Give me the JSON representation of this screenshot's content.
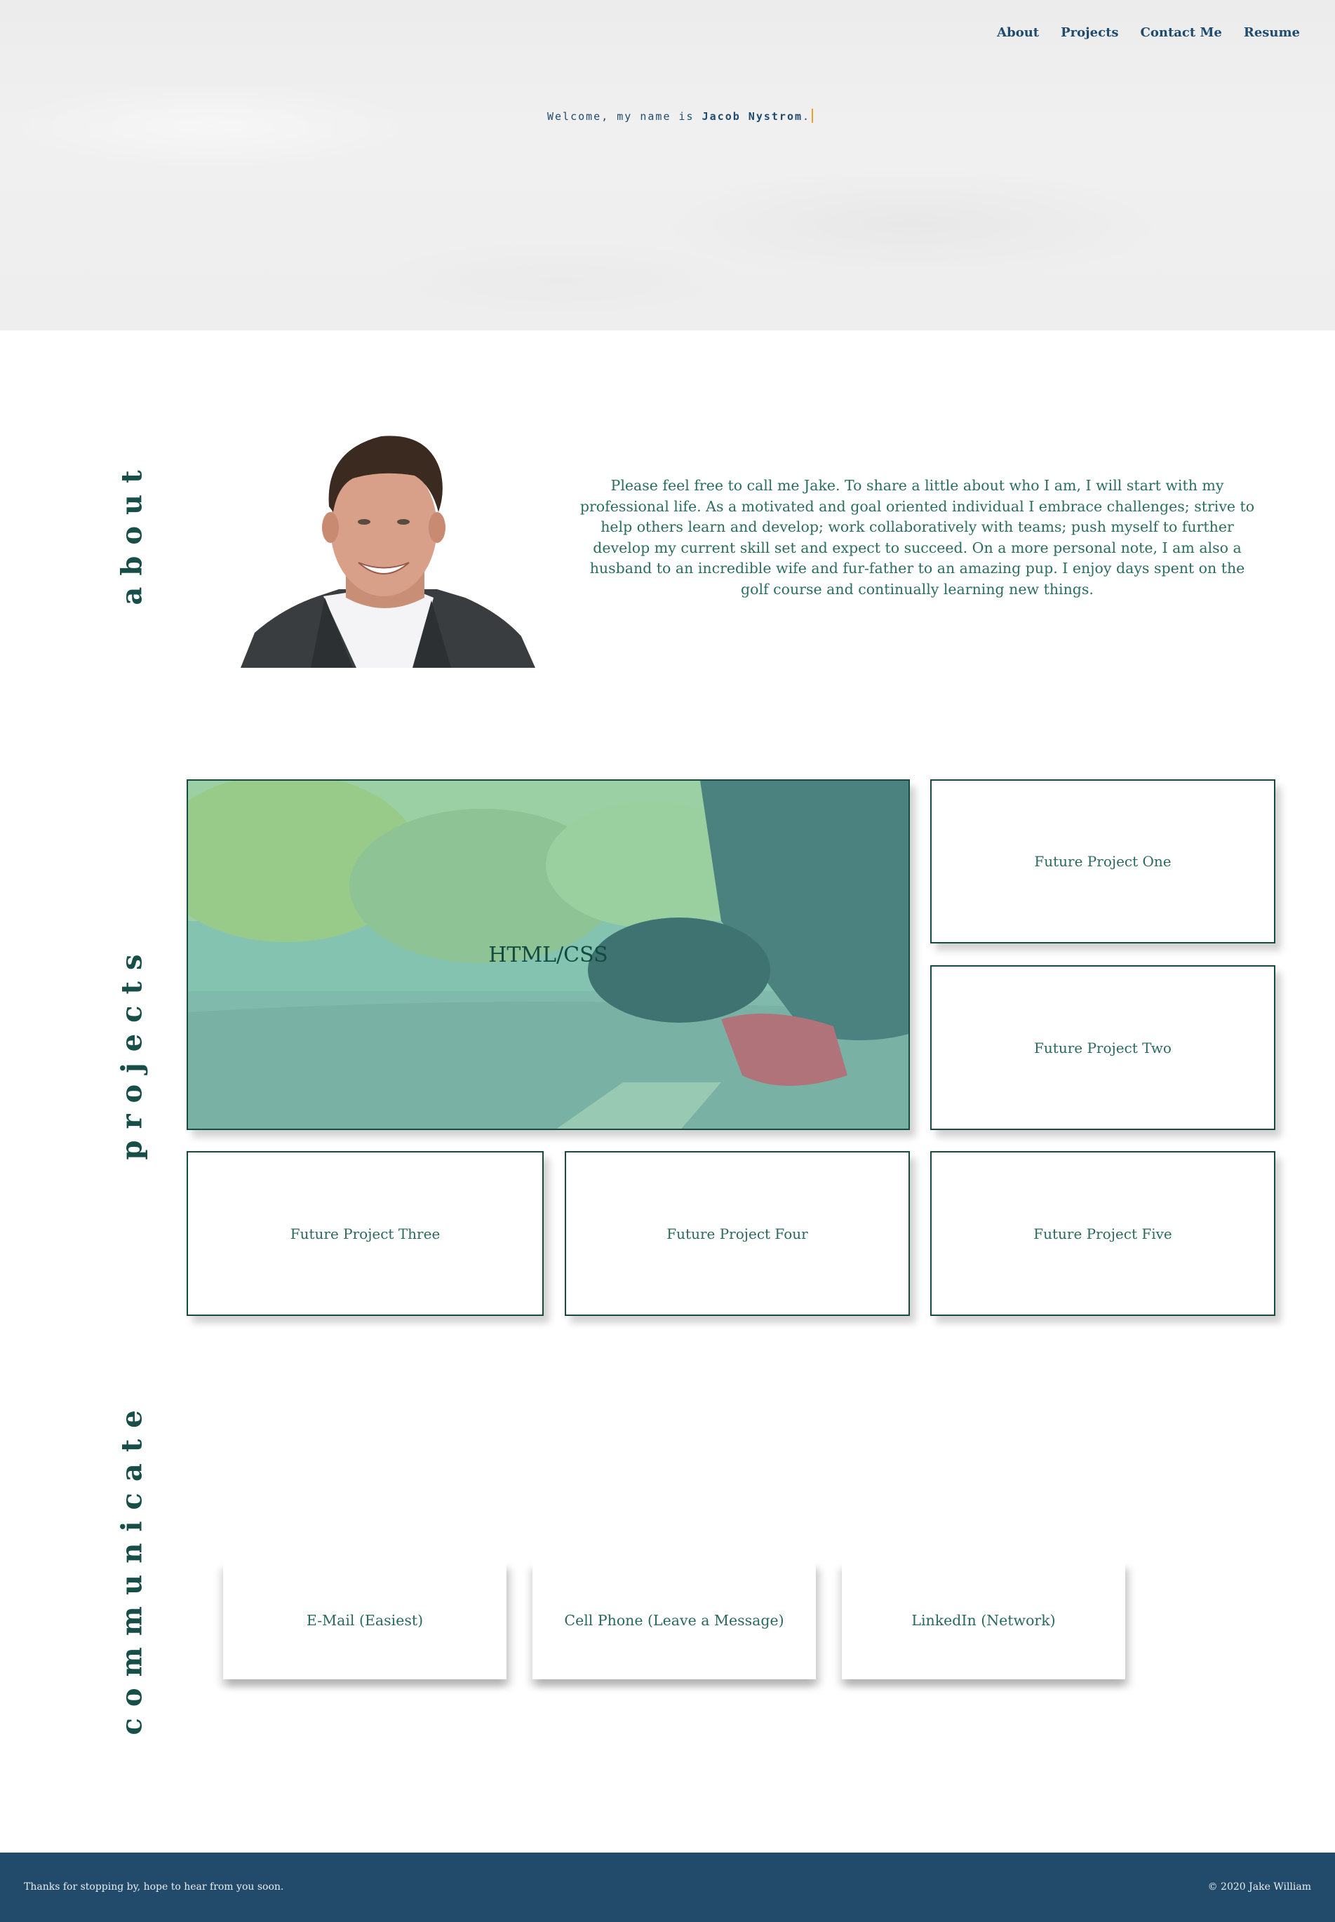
{
  "nav": {
    "items": [
      "About",
      "Projects",
      "Contact Me",
      "Resume"
    ]
  },
  "hero": {
    "welcome_prefix": "Welcome, my name is ",
    "name": "Jacob Nystrom",
    "suffix": "."
  },
  "sections": {
    "about": "about",
    "projects": "projects",
    "communicate": "communicate"
  },
  "about": {
    "text": "Please feel free to call me Jake. To share a little about who I am, I will start with my professional life. As a motivated and goal oriented individual I embrace challenges; strive to help others learn and develop; work collaboratively with teams; push myself to further develop my current skill set and expect to succeed. On a more personal note, I am also a husband to an incredible wife and fur-father to an amazing pup. I enjoy days spent on the golf course and continually learning new things."
  },
  "projects": {
    "featured": "HTML/CSS",
    "items": [
      "Future Project One",
      "Future Project Two",
      "Future Project Three",
      "Future Project Four",
      "Future Project Five"
    ]
  },
  "communicate": {
    "items": [
      "E-Mail (Easiest)",
      "Cell Phone (Leave a Message)",
      "LinkedIn (Network)"
    ]
  },
  "footer": {
    "left": "Thanks for stopping by, hope to hear from you soon.",
    "right": "© 2020 Jake William"
  },
  "colors": {
    "accent": "#1d5e52",
    "nav": "#1f4b6e",
    "footer_bg": "#224a6b",
    "caret": "#f0a020"
  }
}
